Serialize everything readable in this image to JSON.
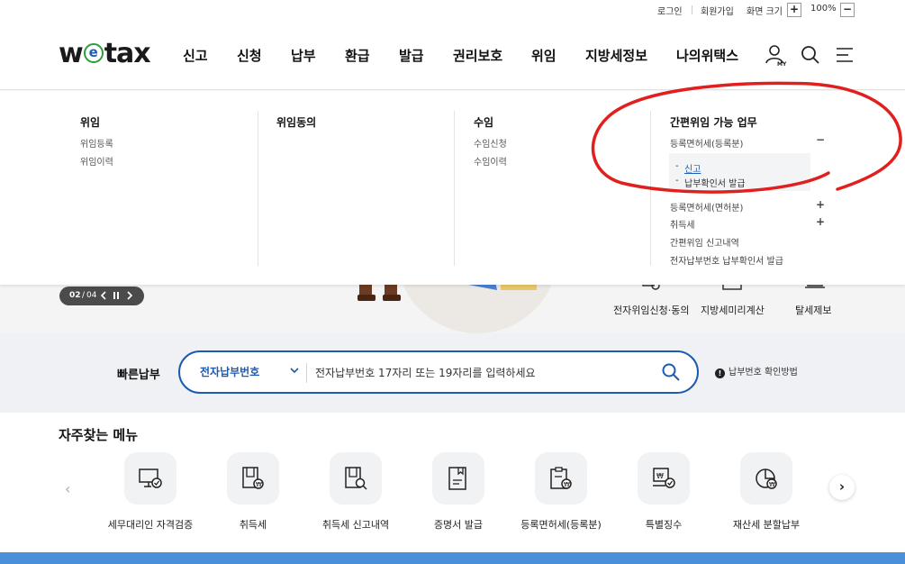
{
  "util": {
    "login": "로그인",
    "signup": "회원가입",
    "zoom_label": "화면 크기",
    "zoom_in": "+",
    "zoom_value": "100%",
    "zoom_out": "−"
  },
  "logo": {
    "pre": "w",
    "mid": "e",
    "post": "tax"
  },
  "gnb": [
    "신고",
    "신청",
    "납부",
    "환급",
    "발급",
    "권리보호",
    "위임",
    "지방세정보",
    "나의위택스"
  ],
  "header_icons": {
    "my": "MY"
  },
  "panel": {
    "col1": {
      "title": "위임",
      "links": [
        "위임등록",
        "위임이력"
      ]
    },
    "col2": {
      "title": "위임동의"
    },
    "col3": {
      "title": "수임",
      "links": [
        "수임신청",
        "수임이력"
      ]
    },
    "col4": {
      "title": "간편위임 가능 업무",
      "group1": "등록면허세(등록분)",
      "group1_toggle": "−",
      "group1_subs": [
        "신고",
        "납부확인서 발급"
      ],
      "sub_prefix": "-",
      "group2": "등록면허세(면허분)",
      "group2_toggle": "+",
      "group3": "취득세",
      "group3_toggle": "+",
      "link4": "간편위임 신고내역",
      "link5": "전자납부번호 납부확인서 발급"
    }
  },
  "hero": {
    "pager_current": "02",
    "pager_sep": "/",
    "pager_total": "04",
    "quick": [
      "전자위임신청·동의",
      "지방세미리계산",
      "탈세제보"
    ]
  },
  "fastpay": {
    "label": "빠른납부",
    "select": "전자납부번호",
    "placeholder": "전자납부번호 17자리 또는 19자리를 입력하세요",
    "howto_mark": "!",
    "howto": "납부번호 확인방법"
  },
  "frequent": {
    "title": "자주찾는 메뉴",
    "items": [
      {
        "label": "세무대리인 자격검증",
        "icon": "monitor-check-icon"
      },
      {
        "label": "취득세",
        "icon": "doc-won-icon"
      },
      {
        "label": "취득세 신고내역",
        "icon": "doc-search-icon"
      },
      {
        "label": "증명서 발급",
        "icon": "certificate-icon"
      },
      {
        "label": "등록면허세(등록분)",
        "icon": "clipboard-won-icon"
      },
      {
        "label": "특별징수",
        "icon": "box-won-check-icon"
      },
      {
        "label": "재산세 분할납부",
        "icon": "pie-won-icon"
      }
    ],
    "prev": "‹",
    "next": "›"
  },
  "colors": {
    "accent": "#1c5bb0",
    "annotation": "#e0201e",
    "logo_green": "#2a9d3c"
  }
}
